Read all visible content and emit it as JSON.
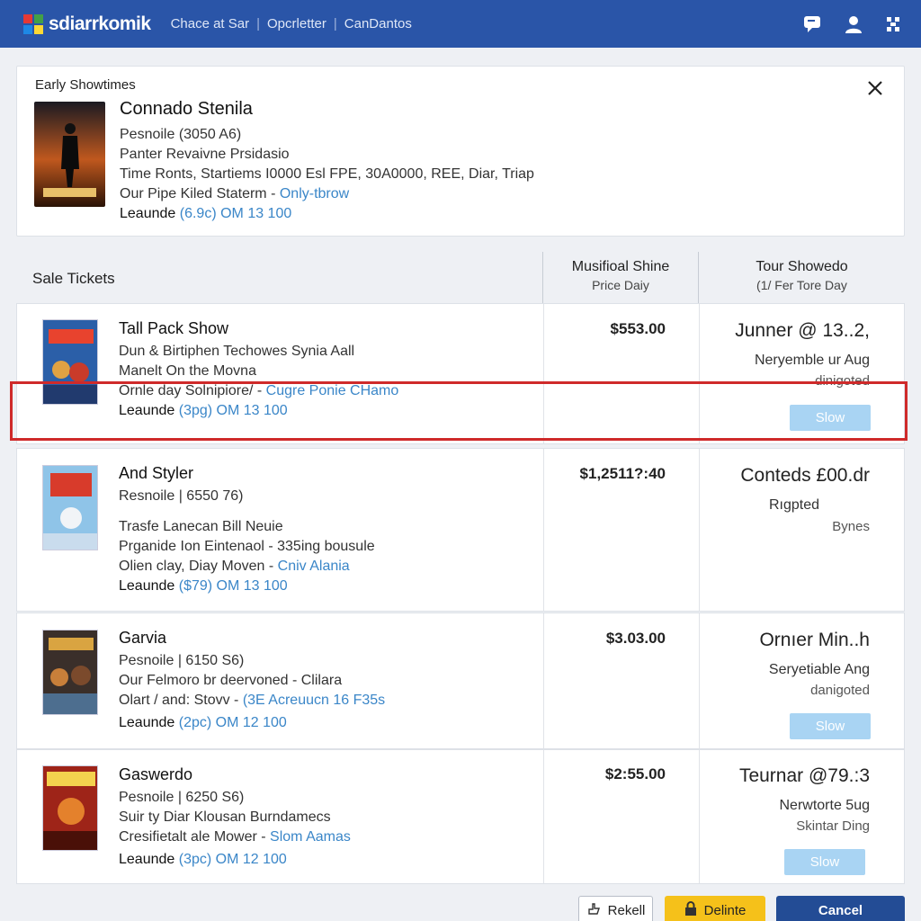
{
  "app": {
    "name": "sdiarrkomik",
    "nav": [
      "Chace at Sar",
      "Opcrletter",
      "CanDantos"
    ],
    "logo_colors": [
      "#e53935",
      "#43a047",
      "#1e88e5",
      "#fdd835"
    ]
  },
  "event": {
    "label": "Early Showtimes",
    "title": "Connado Stenila",
    "subtitle": "Pesnoile (3050 A6)",
    "line1": "Panter Revaivne Prsidasio",
    "line2": "Time Ronts, Startiems I0000 Esl FPE, 30A0000, REE, Diar, Triap",
    "line3_prefix": "Our Pipe Kiled Staterm - ",
    "line3_link": "Only-tbrow",
    "line4_prefix": "Leaunde",
    "line4_value": "(6.9c) OM 13 100"
  },
  "table": {
    "sale_header": "Sale Tickets",
    "col2_header": "Musifioal Shine",
    "col2_sub": "Price Daiy",
    "col3_header": "Tour Showedo",
    "col3_sub": "(1/ Fer Tore Day",
    "rows": [
      {
        "title": "Tall Pack Show",
        "subtitle": "Dun & Birtiphen Techowes Synia Aall",
        "line1": "Manelt On the Movna",
        "line2_prefix": "Ornle day Solnipiore/ - ",
        "line2_link": "Cugre Ponie CHamo",
        "leaunde": "Leaunde",
        "leaunde_value": "(3pg) OM 13 100",
        "price": "$553.00",
        "tour1": "Junner @ 13..2,",
        "tour2": "Neryemble ur Aug",
        "tour3": "dinigoted",
        "button": "Slow"
      },
      {
        "title": "And Styler",
        "subtitle": "Resnoile | 6550 76)",
        "line1": "Trasfe Lanecan Bill Neuie",
        "line2": "Prganide Ion Eintenaol - 335ing bousule",
        "line3_prefix": "Olien clay, Diay Moven - ",
        "line3_link": "Cniv Alania",
        "leaunde": "Leaunde",
        "leaunde_value": "($79) OM 13 100",
        "price": "$1,2511?:40",
        "tour1": "Conteds £00.dr",
        "tour2": "Rıgpted",
        "tour3": "Bynes"
      },
      {
        "title": "Garvia",
        "subtitle": "Pesnoile | 6150 S6)",
        "line1": "Our Felmoro br deervoned - Clilara",
        "line2_prefix": "Olart / and: Stovv - ",
        "line2_link": "(3E Acreuucn 16 F35s",
        "leaunde": "Leaunde",
        "leaunde_value": "(2pc) OM 12 100",
        "price": "$3.03.00",
        "tour1": "Ornıer Min..h",
        "tour2": "Seryetiable Ang",
        "tour3": "danigoted",
        "button": "Slow"
      },
      {
        "title": "Gaswerdo",
        "subtitle": "Pesnoile | 6250 S6)",
        "line1": "Suir ty Diar Klousan Burndamecs",
        "line2_prefix": "Cresifietalt ale Mower - ",
        "line2_link": "Slom Aamas",
        "leaunde": "Leaunde",
        "leaunde_value": "(3pc) OM 12 100",
        "price": "$2:55.00",
        "tour1": "Teurnar @79.:3",
        "tour2": "Nerwtorte 5ug",
        "tour3": "Skintar Ding",
        "button": "Slow"
      }
    ]
  },
  "footer": {
    "rekell": "Rekell",
    "delinte": "Delinte",
    "cancel": "Cancel"
  }
}
